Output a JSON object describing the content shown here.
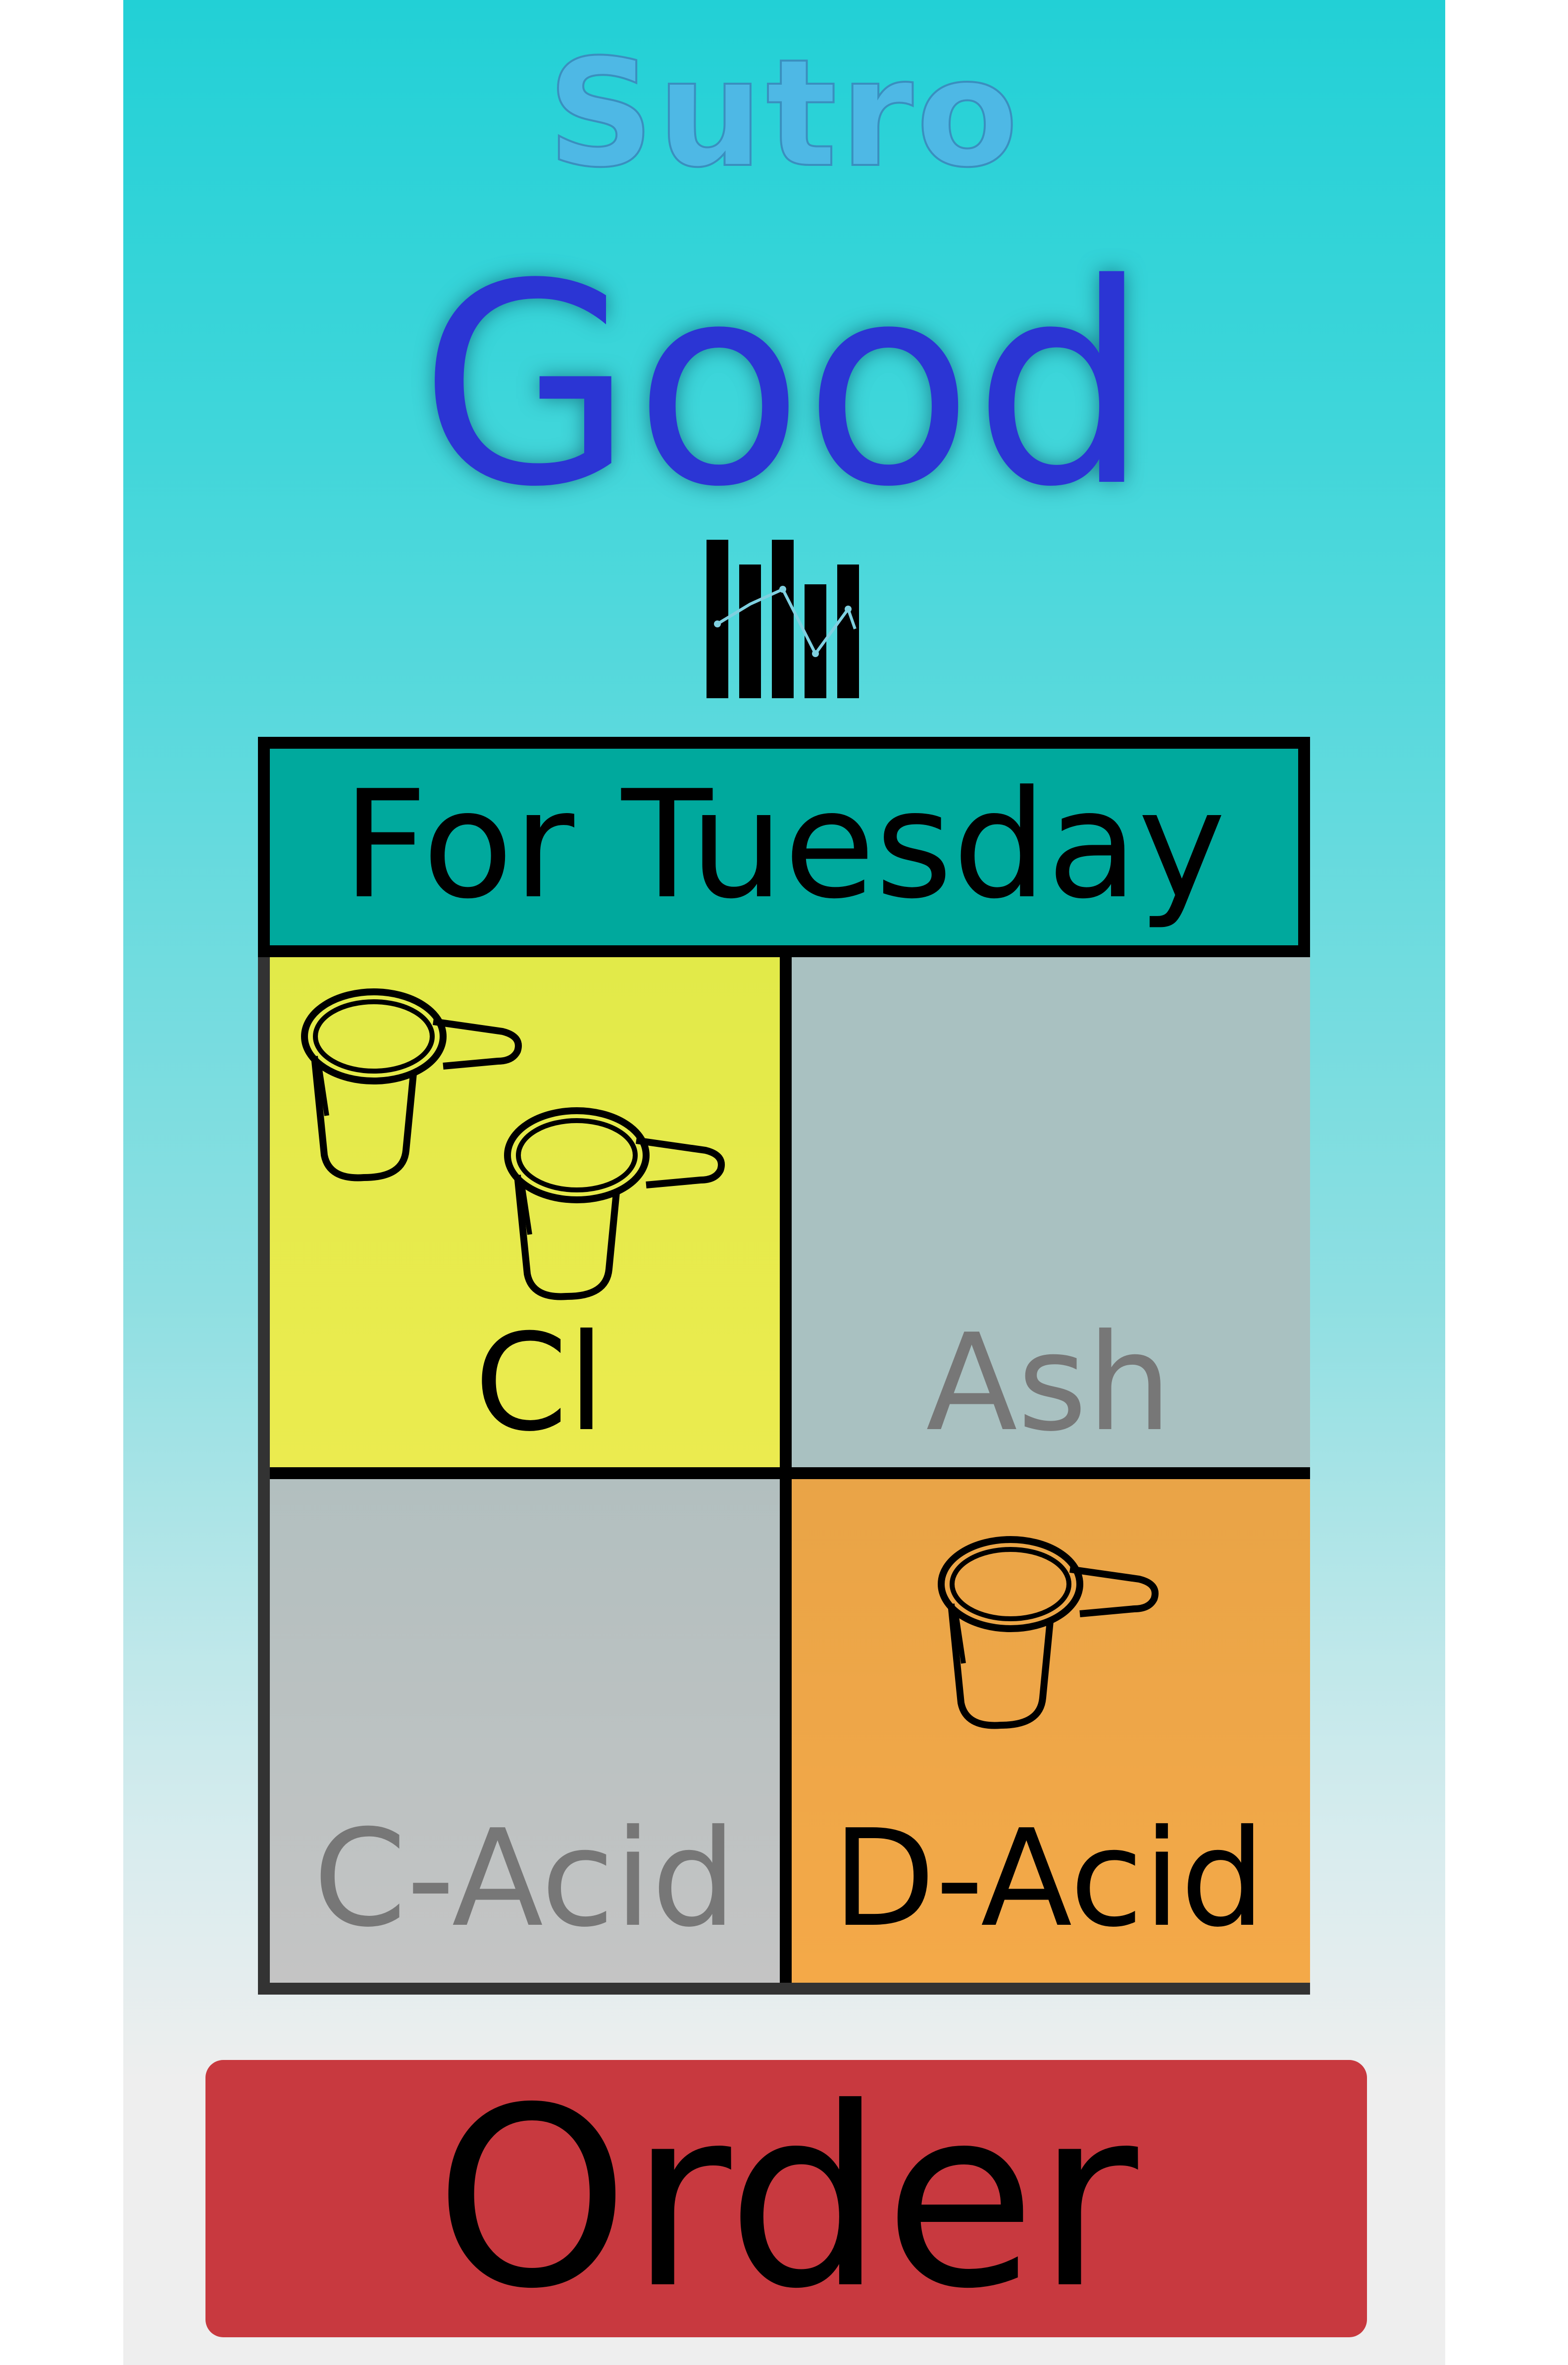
{
  "app": {
    "brand": "Sutro",
    "status": "Good",
    "icons": {
      "chart": "bar-line-chart-icon",
      "cup": "measuring-cup-icon"
    }
  },
  "schedule": {
    "title": "For Tuesday",
    "items": [
      {
        "label": "Cl",
        "doses": 2,
        "color": "#e6ea4b",
        "active": true
      },
      {
        "label": "Ash",
        "doses": 0,
        "color": "#a9c1c1",
        "active": false
      },
      {
        "label": "C-Acid",
        "doses": 0,
        "color": "#bcc2c2",
        "active": false
      },
      {
        "label": "D-Acid",
        "doses": 1,
        "color": "#f0a748",
        "active": true
      }
    ]
  },
  "actions": {
    "order_label": "Order"
  },
  "colors": {
    "brand": "#4eb8e5",
    "status_good": "#2b35d4",
    "title_bar": "#00a99d",
    "order_button": "#c8393f"
  }
}
